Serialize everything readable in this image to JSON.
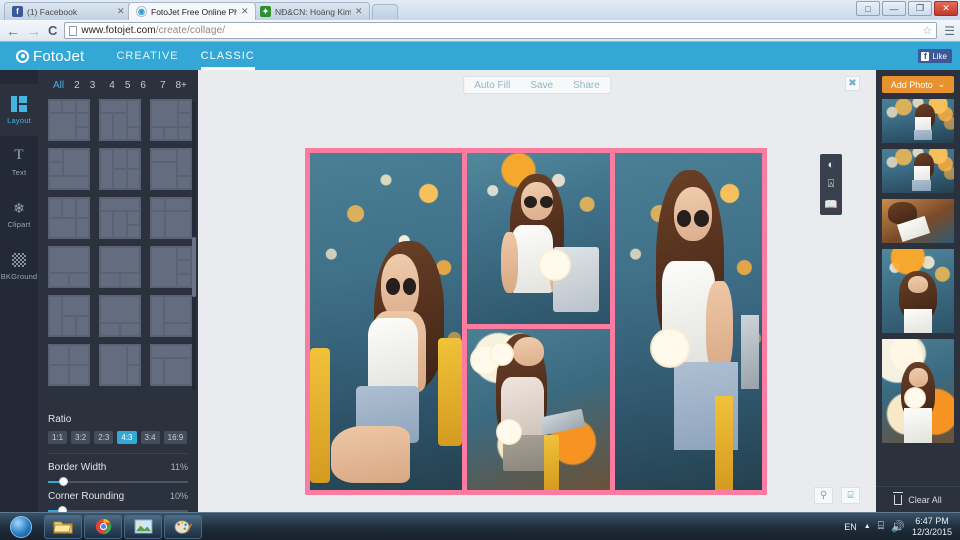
{
  "browser": {
    "tabs": [
      {
        "title": "(1) Facebook",
        "favicon": "facebook-icon",
        "active": false
      },
      {
        "title": "FotoJet Free Online Photo",
        "favicon": "fotojet-icon",
        "active": true
      },
      {
        "title": "NĐ&CN: Hoàng Kim Phư",
        "favicon": "site-icon",
        "active": false
      }
    ],
    "close_label": "✕",
    "new_tab_label": "",
    "window_controls": {
      "account": "□",
      "minimize": "—",
      "maximize": "❐",
      "close": "✕"
    },
    "nav": {
      "back": "←",
      "forward": "→",
      "reload": "C"
    },
    "url_domain": "www.fotojet.com",
    "url_path": "/create/collage/",
    "star_icon": "☆",
    "menu_icon": "☰"
  },
  "appbar": {
    "brand": "FotoJet",
    "tabs": [
      {
        "label": "CREATIVE",
        "active": false
      },
      {
        "label": "CLASSIC",
        "active": true
      }
    ],
    "facebook_like": {
      "f": "f",
      "label": "Like"
    }
  },
  "rail": {
    "items": [
      {
        "label": "Layout",
        "icon": "layout-icon",
        "active": true
      },
      {
        "label": "Text",
        "icon": "text-icon",
        "active": false
      },
      {
        "label": "Clipart",
        "icon": "clipart-icon",
        "active": false
      },
      {
        "label": "BKGround",
        "icon": "background-icon",
        "active": false
      }
    ]
  },
  "panel": {
    "counts": [
      "All",
      "2",
      "3",
      "4",
      "5",
      "6",
      "7",
      "8+"
    ],
    "active_count": "All",
    "ratio_title": "Ratio",
    "ratios": [
      "1:1",
      "3:2",
      "2:3",
      "4:3",
      "3:4",
      "16:9"
    ],
    "active_ratio": "4:3",
    "border_width": {
      "label": "Border Width",
      "value": "11%",
      "percent": 11
    },
    "corner_rounding": {
      "label": "Corner Rounding",
      "value": "10%",
      "percent": 10
    }
  },
  "stage": {
    "actions": [
      "Auto Fill",
      "Save",
      "Share"
    ],
    "close_icon": "✖",
    "tools": [
      {
        "icon": "contrast-icon"
      },
      {
        "icon": "crop-icon"
      },
      {
        "icon": "book-icon"
      }
    ],
    "bottom_tools": [
      {
        "icon": "zoom-out-icon",
        "glyph": "⚲"
      },
      {
        "icon": "feedback-icon",
        "glyph": "⌸"
      }
    ],
    "collage": {
      "border_color": "#fb7ca0",
      "cells": [
        {
          "name": "photo-cell-1",
          "description": "woman seated on yellow chair with glasses"
        },
        {
          "name": "photo-cell-2",
          "description": "woman holding tablet, string lights"
        },
        {
          "name": "photo-cell-3",
          "description": "woman seated using tablet, warm bokeh"
        },
        {
          "name": "photo-cell-4",
          "description": "woman standing with tablet, blue backdrop"
        }
      ]
    }
  },
  "photos": {
    "add_button": {
      "label": "Add Photo",
      "chevron": "⌄"
    },
    "thumbnails": [
      {
        "name": "photo-thumb-1",
        "orientation": "landscape"
      },
      {
        "name": "photo-thumb-2",
        "orientation": "landscape"
      },
      {
        "name": "photo-thumb-3",
        "orientation": "landscape"
      },
      {
        "name": "photo-thumb-4",
        "orientation": "portrait"
      },
      {
        "name": "photo-thumb-5",
        "orientation": "portrait"
      }
    ],
    "clear_all": "Clear All"
  },
  "taskbar": {
    "start": "start-orb",
    "items": [
      "file-explorer-icon",
      "chrome-icon",
      "photo-viewer-icon",
      "paint-icon"
    ],
    "language": "EN",
    "show_hidden": "▲",
    "network_icon": "⌸",
    "volume_icon": "🔊",
    "time": "6:47 PM",
    "date": "12/3/2015"
  }
}
